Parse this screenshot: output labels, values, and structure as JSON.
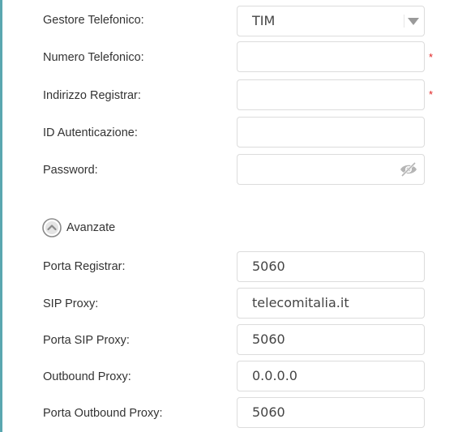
{
  "form": {
    "carrier": {
      "label": "Gestore Telefonico:",
      "value": "TIM"
    },
    "phone_number": {
      "label": "Numero Telefonico:",
      "value": "",
      "required_mark": "*"
    },
    "registrar_address": {
      "label": "Indirizzo Registrar:",
      "value": "",
      "required_mark": "*"
    },
    "auth_id": {
      "label": "ID Autenticazione:",
      "value": ""
    },
    "password": {
      "label": "Password:",
      "value": "",
      "toggle_icon": "eye-slash-icon"
    }
  },
  "advanced": {
    "toggle_label": "Avanzate",
    "toggle_icon": "chevron-up-circle-icon",
    "registrar_port": {
      "label": "Porta Registrar:",
      "value": "5060"
    },
    "sip_proxy": {
      "label": "SIP Proxy:",
      "value": "telecomitalia.it"
    },
    "sip_proxy_port": {
      "label": "Porta SIP Proxy:",
      "value": "5060"
    },
    "outbound_proxy": {
      "label": "Outbound Proxy:",
      "value": "0.0.0.0"
    },
    "outbound_proxy_port": {
      "label": "Porta Outbound Proxy:",
      "value": "5060"
    }
  },
  "colors": {
    "accent_rule": "#5aa7b0",
    "required": "#e02020",
    "border": "#dcdcdc"
  }
}
